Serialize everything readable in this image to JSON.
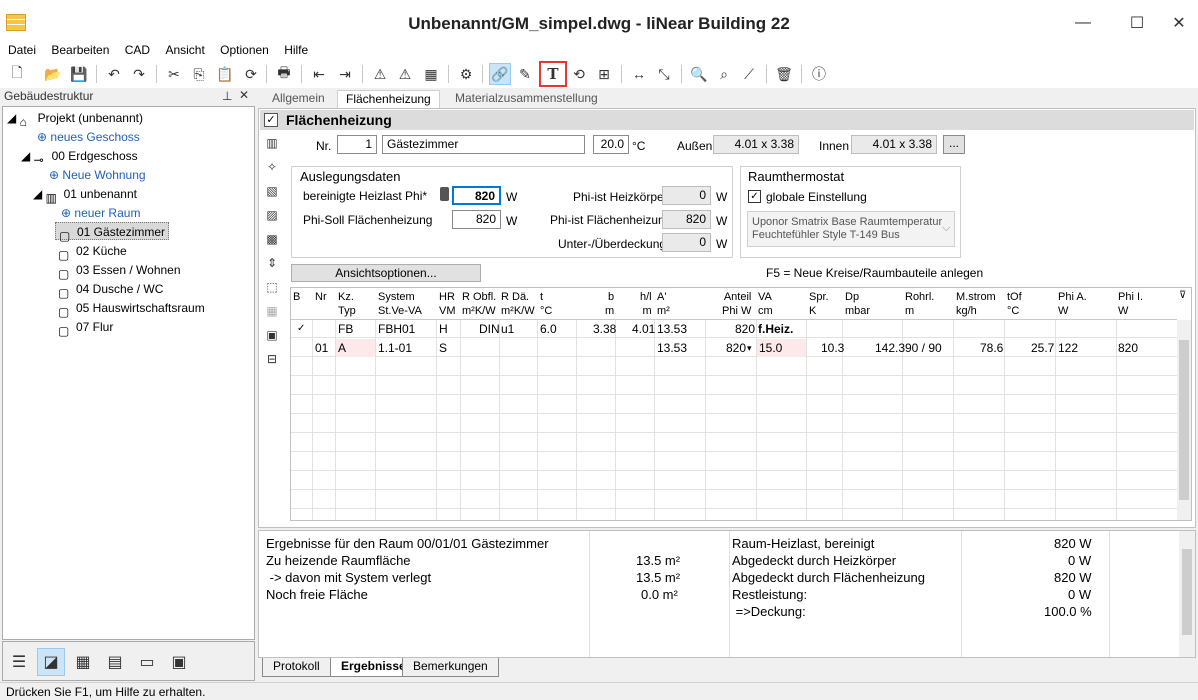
{
  "window": {
    "title": "Unbenannt/GM_simpel.dwg - liNear Building 22"
  },
  "menu": [
    "Datei",
    "Bearbeiten",
    "CAD",
    "Ansicht",
    "Optionen",
    "Hilfe"
  ],
  "left": {
    "header": "Gebäudestruktur",
    "tree": [
      "Projekt (unbenannt)",
      "neues Geschoss",
      "00 Erdgeschoss",
      "Neue Wohnung",
      "01 unbenannt",
      "neuer Raum",
      "01 Gästezimmer",
      "02 Küche",
      "03 Essen / Wohnen",
      "04 Dusche / WC",
      "05 Hauswirtschaftsraum",
      "07 Flur"
    ]
  },
  "tabs": [
    "Allgemein",
    "Flächenheizung",
    "Materialzusammenstellung"
  ],
  "section": {
    "title": "Flächenheizung"
  },
  "room": {
    "nr_label": "Nr.",
    "nr": "1",
    "name": "Gästezimmer",
    "temp": "20.0",
    "temp_unit": "°C",
    "aussen_label": "Außen",
    "aussen": "4.01 x 3.38",
    "innen_label": "Innen",
    "innen": "4.01 x 3.38",
    "more": "..."
  },
  "auslegung": {
    "title": "Auslegungsdaten",
    "heizlast_label": "bereinigte Heizlast Phi*",
    "heizlast": "820",
    "unit": "W",
    "soll_label": "Phi-Soll Flächenheizung",
    "soll": "820",
    "ist_hk_label": "Phi-ist Heizkörper",
    "ist_hk": "0",
    "ist_fh_label": "Phi-ist Flächenheizung",
    "ist_fh": "820",
    "ueber_label": "Unter-/Überdeckung",
    "ueber": "0"
  },
  "thermostat": {
    "title": "Raumthermostat",
    "global_label": "globale Einstellung",
    "device_line1": "Uponor Smatrix Base Raumtemperatur",
    "device_line2": "Feuchtefühler Style T-149 Bus"
  },
  "ansicht_button": "Ansichtsoptionen...",
  "f5_hint": "F5 = Neue Kreise/Raumbauteile anlegen",
  "grid": {
    "headers": [
      [
        "B",
        ""
      ],
      [
        "Nr",
        ""
      ],
      [
        "Kz.",
        "Typ"
      ],
      [
        "System",
        "St.Ve-VA"
      ],
      [
        "HR",
        "VM"
      ],
      [
        "R Obfl.",
        "m²K/W"
      ],
      [
        "R Dä.",
        "m²K/W"
      ],
      [
        "t",
        "°C"
      ],
      [
        "b",
        "m"
      ],
      [
        "h/l",
        "m"
      ],
      [
        "A'",
        "m²"
      ],
      [
        "Anteil",
        "Phi W"
      ],
      [
        "VA",
        "cm"
      ],
      [
        "Spr.",
        "K"
      ],
      [
        "Dp",
        "mbar"
      ],
      [
        "Rohrl.",
        "m"
      ],
      [
        "M.strom",
        "kg/h"
      ],
      [
        "tOf",
        "°C"
      ],
      [
        "Phi A.",
        "W"
      ],
      [
        "Phi I.",
        "W"
      ]
    ],
    "row1": {
      "b": "✓",
      "kz": "FB",
      "system": "FBH01",
      "hr": "H",
      "robfl": "DIN",
      "rdae": "u1",
      "t": "6.0",
      "b_m": "3.38",
      "hl": "4.01",
      "a": "13.53",
      "anteil": "820",
      "va": "f.Heiz."
    },
    "row2": {
      "nr": "01",
      "kz": "A",
      "system": "1.1-01",
      "hr": "S",
      "a": "13.53",
      "anteil": "820",
      "va": "15.0",
      "spr": "10.3",
      "dp": "142.3",
      "rohrl": "90 / 90",
      "mstrom": "78.6",
      "tof": "25.7",
      "phia": "122",
      "phii": "820"
    }
  },
  "results": {
    "left": [
      [
        "Ergebnisse für den Raum 00/01/01 Gästezimmer",
        ""
      ],
      [
        "Zu heizende Raumfläche",
        "13.5 m²"
      ],
      [
        " -> davon mit System verlegt",
        "13.5 m²"
      ],
      [
        "Noch freie Fläche",
        "0.0 m²"
      ]
    ],
    "right": [
      [
        "Raum-Heizlast, bereinigt",
        "820 W"
      ],
      [
        "Abgedeckt durch Heizkörper",
        "0 W"
      ],
      [
        "Abgedeckt durch Flächenheizung",
        "820 W"
      ],
      [
        "Restleistung:",
        "0 W"
      ],
      [
        " =>Deckung:",
        "100.0 %"
      ]
    ]
  },
  "bottom_tabs": [
    "Protokoll",
    "Ergebnisse",
    "Bemerkungen"
  ],
  "status": "Drücken Sie F1, um Hilfe zu erhalten."
}
